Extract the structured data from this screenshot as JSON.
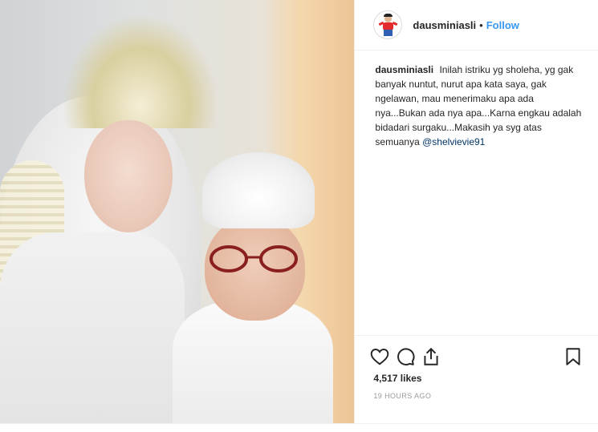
{
  "post": {
    "username": "dausminiasli",
    "separator": "•",
    "follow_label": "Follow",
    "caption": {
      "username": "dausminiasli",
      "text": "Inilah istriku yg sholeha, yg gak banyak nuntut, nurut apa kata saya, gak ngelawan, mau menerimaku apa ada nya...Bukan ada nya apa...Karna engkau adalah bidadari surgaku...Makasih ya syg atas semuanya",
      "mention": "@shelvievie91"
    },
    "likes": "4,517 likes",
    "time_ago": "19 HOURS AGO"
  },
  "icons": {
    "like": "heart-icon",
    "comment": "comment-icon",
    "share": "share-icon",
    "save": "bookmark-icon"
  },
  "colors": {
    "follow": "#3897f0",
    "mention": "#003569",
    "text": "#262626",
    "muted": "#999999",
    "border": "#efefef"
  }
}
